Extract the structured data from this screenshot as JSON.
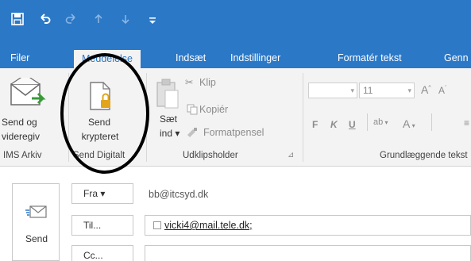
{
  "quick_access": {
    "icons": [
      "save-icon",
      "undo-icon",
      "redo-icon",
      "up-arrow-icon",
      "down-arrow-icon",
      "customize-icon"
    ]
  },
  "tabs": [
    {
      "label": "Filer"
    },
    {
      "label": "Meddelelse"
    },
    {
      "label": "Indsæt"
    },
    {
      "label": "Indstillinger"
    },
    {
      "label": "Formatér tekst"
    },
    {
      "label": "Genn"
    }
  ],
  "ribbon": {
    "ims": {
      "button_line1": "Send og",
      "button_line2": "videregiv",
      "group_label": "IMS Arkiv"
    },
    "send_digitalt": {
      "button_line1": "Send",
      "button_line2": "krypteret",
      "group_label": "Send Digitalt"
    },
    "clipboard": {
      "paste_line1": "Sæt",
      "paste_line2": "ind ▾",
      "cut": "Klip",
      "copy": "Kopiér",
      "format_painter": "Formatpensel",
      "group_label": "Udklipsholder"
    },
    "font": {
      "font_size": "11",
      "grow": "A",
      "shrink": "A",
      "bold": "F",
      "italic": "K",
      "underline": "U",
      "highlight": "ab",
      "font_color": "A",
      "group_label": "Grundlæggende tekst"
    }
  },
  "compose": {
    "send_label": "Send",
    "from_button": "Fra ▾",
    "from_value": "bb@itcsyd.dk",
    "to_button": "Til...",
    "to_value": "vicki4@mail.tele.dk;",
    "cc_button": "Cc..."
  },
  "colors": {
    "titlebar": "#2b78c7",
    "ribbon_bg": "#f3f3f3",
    "annotation_circle": "#000000"
  }
}
